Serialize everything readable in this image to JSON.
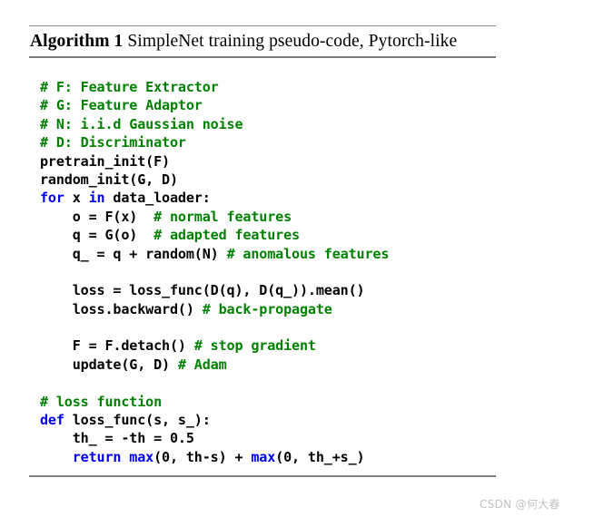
{
  "document": {
    "title_label": "Algorithm 1",
    "title_caption": " SimpleNet training pseudo-code, Pytorch-like",
    "watermark": "CSDN @何大春"
  },
  "colors": {
    "comment": "#008000",
    "keyword": "#0000ee",
    "plain": "#000000",
    "rule": "#808080",
    "watermark": "#c2c2c2"
  },
  "code": {
    "lines": [
      {
        "id": "line-1",
        "tokens": [
          {
            "text": "# F: Feature Extractor",
            "type": "comment"
          }
        ]
      },
      {
        "id": "line-2",
        "tokens": [
          {
            "text": "# G: Feature Adaptor",
            "type": "comment"
          }
        ]
      },
      {
        "id": "line-3",
        "tokens": [
          {
            "text": "# N: i.i.d Gaussian noise",
            "type": "comment"
          }
        ]
      },
      {
        "id": "line-4",
        "tokens": [
          {
            "text": "# D: Discriminator",
            "type": "comment"
          }
        ]
      },
      {
        "id": "line-5",
        "tokens": [
          {
            "text": "pretrain_init(F)",
            "type": "plain"
          }
        ]
      },
      {
        "id": "line-6",
        "tokens": [
          {
            "text": "random_init(G, D)",
            "type": "plain"
          }
        ]
      },
      {
        "id": "line-7",
        "tokens": [
          {
            "text": "for",
            "type": "keyword"
          },
          {
            "text": " x ",
            "type": "plain"
          },
          {
            "text": "in",
            "type": "keyword"
          },
          {
            "text": " data_loader:",
            "type": "plain"
          }
        ]
      },
      {
        "id": "line-8",
        "tokens": [
          {
            "text": "    o = F(x)  ",
            "type": "plain"
          },
          {
            "text": "# normal features",
            "type": "comment"
          }
        ]
      },
      {
        "id": "line-9",
        "tokens": [
          {
            "text": "    q = G(o)  ",
            "type": "plain"
          },
          {
            "text": "# adapted features",
            "type": "comment"
          }
        ]
      },
      {
        "id": "line-10",
        "tokens": [
          {
            "text": "    q_ = q + random(N) ",
            "type": "plain"
          },
          {
            "text": "# anomalous features",
            "type": "comment"
          }
        ]
      },
      {
        "id": "line-11",
        "tokens": [
          {
            "text": "",
            "type": "plain"
          }
        ]
      },
      {
        "id": "line-12",
        "tokens": [
          {
            "text": "    loss = loss_func(D(q), D(q_)).mean()",
            "type": "plain"
          }
        ]
      },
      {
        "id": "line-13",
        "tokens": [
          {
            "text": "    loss.backward() ",
            "type": "plain"
          },
          {
            "text": "# back-propagate",
            "type": "comment"
          }
        ]
      },
      {
        "id": "line-14",
        "tokens": [
          {
            "text": "",
            "type": "plain"
          }
        ]
      },
      {
        "id": "line-15",
        "tokens": [
          {
            "text": "    F = F.detach() ",
            "type": "plain"
          },
          {
            "text": "# stop gradient",
            "type": "comment"
          }
        ]
      },
      {
        "id": "line-16",
        "tokens": [
          {
            "text": "    update(G, D) ",
            "type": "plain"
          },
          {
            "text": "# Adam",
            "type": "comment"
          }
        ]
      },
      {
        "id": "line-17",
        "tokens": [
          {
            "text": "",
            "type": "plain"
          }
        ]
      },
      {
        "id": "line-18",
        "tokens": [
          {
            "text": "# loss function",
            "type": "comment"
          }
        ]
      },
      {
        "id": "line-19",
        "tokens": [
          {
            "text": "def",
            "type": "keyword"
          },
          {
            "text": " loss_func(s, s_):",
            "type": "plain"
          }
        ]
      },
      {
        "id": "line-20",
        "tokens": [
          {
            "text": "    th_ = -th = 0.5",
            "type": "plain"
          }
        ]
      },
      {
        "id": "line-21",
        "tokens": [
          {
            "text": "    ",
            "type": "plain"
          },
          {
            "text": "return max",
            "type": "keyword"
          },
          {
            "text": "(0, th-s) + ",
            "type": "plain"
          },
          {
            "text": "max",
            "type": "keyword"
          },
          {
            "text": "(0, th_+s_)",
            "type": "plain"
          }
        ]
      }
    ]
  }
}
